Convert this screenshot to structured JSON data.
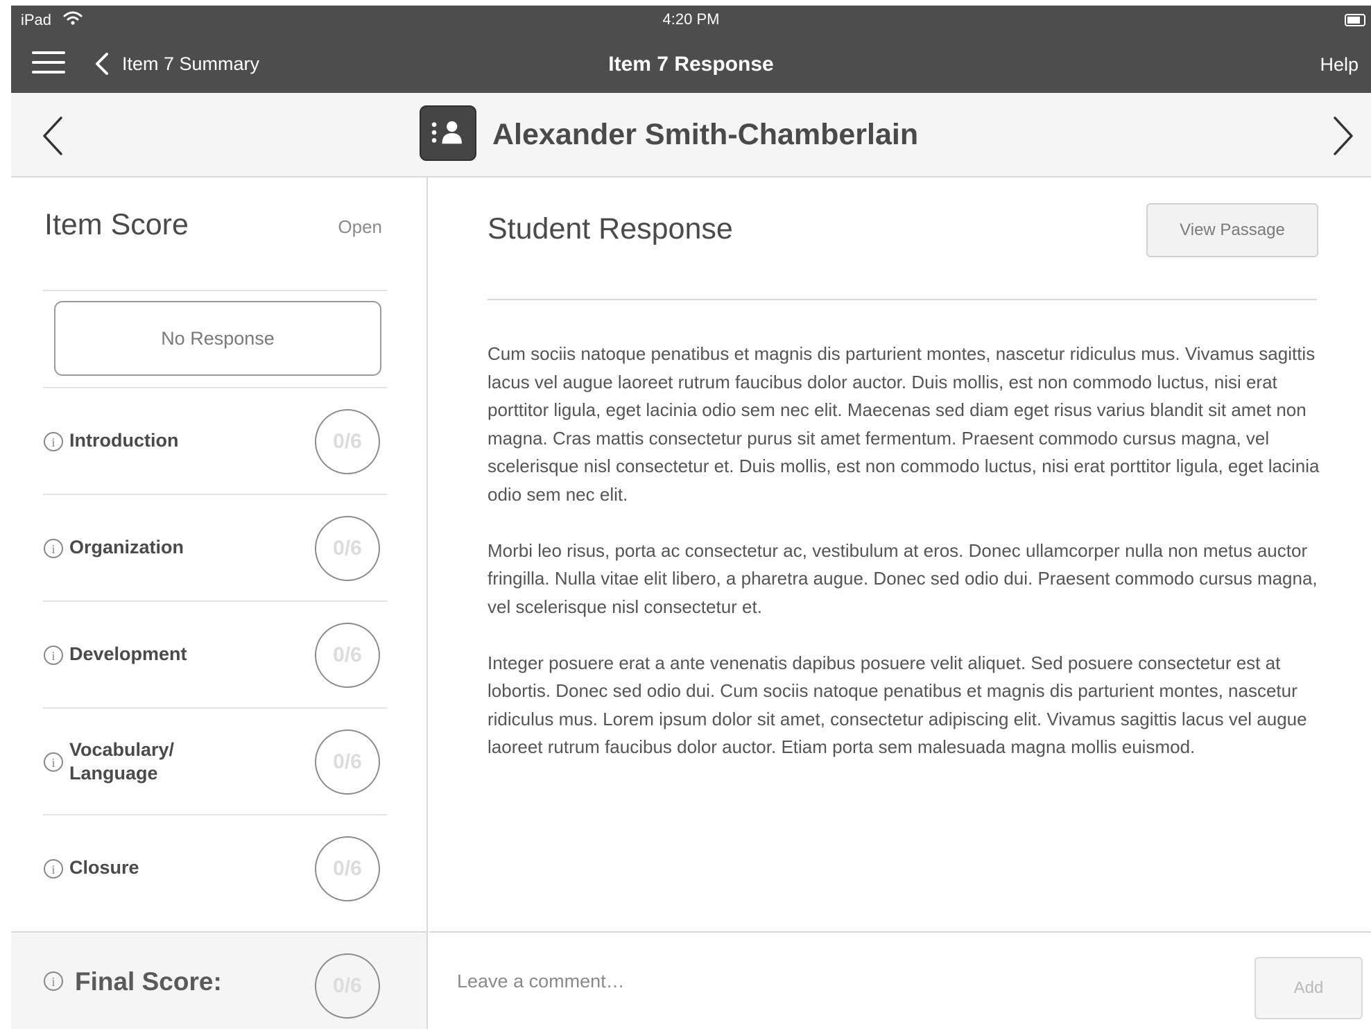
{
  "status_bar": {
    "device": "iPad",
    "time": "4:20 PM"
  },
  "nav": {
    "back_label": "Item 7 Summary",
    "title": "Item 7 Response",
    "help_label": "Help"
  },
  "student": {
    "name": "Alexander Smith-Chamberlain"
  },
  "score_panel": {
    "title": "Item Score",
    "status": "Open",
    "no_response_label": "No Response",
    "criteria": [
      {
        "label": "Introduction",
        "score": "0/6"
      },
      {
        "label": "Organization",
        "score": "0/6"
      },
      {
        "label": "Development",
        "score": "0/6"
      },
      {
        "label": "Vocabulary/\nLanguage",
        "score": "0/6"
      },
      {
        "label": "Closure",
        "score": "0/6"
      }
    ],
    "final_label": "Final Score:",
    "final_score": "0/6"
  },
  "response": {
    "title": "Student Response",
    "view_passage_label": "View Passage",
    "paragraphs": [
      "Cum sociis natoque penatibus et magnis dis parturient montes, nascetur ridiculus mus. Vivamus sagittis lacus vel augue laoreet rutrum faucibus dolor auctor. Duis mollis, est non commodo luctus, nisi erat porttitor ligula, eget lacinia odio sem nec elit. Maecenas sed diam eget risus varius blandit sit amet non magna. Cras mattis consectetur purus sit amet fermentum. Praesent commodo cursus magna, vel scelerisque nisl consectetur et. Duis mollis, est non commodo luctus, nisi erat porttitor ligula, eget lacinia odio sem nec elit.",
      "Morbi leo risus, porta ac consectetur ac, vestibulum at eros. Donec ullamcorper nulla non metus auctor fringilla. Nulla vitae elit libero, a pharetra augue. Donec sed odio dui. Praesent commodo cursus magna, vel scelerisque nisl consectetur et.",
      "Integer posuere erat a ante venenatis dapibus posuere velit aliquet. Sed posuere consectetur est at lobortis. Donec sed odio dui. Cum sociis natoque penatibus et magnis dis parturient montes, nascetur ridiculus mus. Lorem ipsum dolor sit amet, consectetur adipiscing elit. Vivamus sagittis lacus vel augue laoreet rutrum faucibus dolor auctor. Etiam porta sem malesuada magna mollis euismod."
    ]
  },
  "comment": {
    "placeholder": "Leave a comment…",
    "add_label": "Add"
  }
}
